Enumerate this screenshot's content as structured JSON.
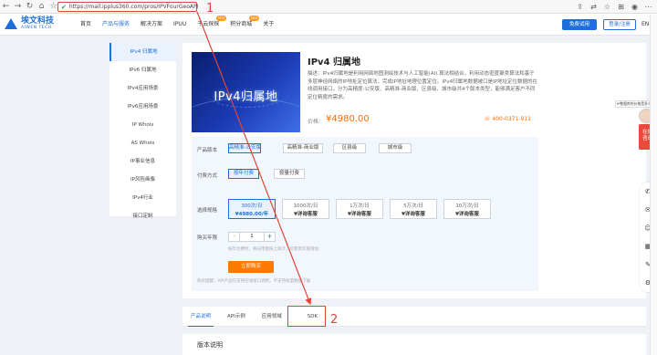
{
  "browser": {
    "url": "https://mail.ipplus360.com/pros/IPVFourGeoAPI"
  },
  "header": {
    "logo_cn": "埃文科技",
    "logo_en": "AIWEN TECH",
    "menu": [
      {
        "label": "首页",
        "badge": ""
      },
      {
        "label": "产品与服务",
        "badge": ""
      },
      {
        "label": "解决方案",
        "badge": ""
      },
      {
        "label": "IPUU",
        "badge": ""
      },
      {
        "label": "千云探探",
        "badge": "Hot"
      },
      {
        "label": "积分商城",
        "badge": "Hot"
      },
      {
        "label": "关于",
        "badge": ""
      }
    ],
    "trial_button": "免费试用",
    "login_button": "登录/注册",
    "lang": "EN"
  },
  "sidebar": {
    "items": [
      {
        "label": "IPv4 归属地"
      },
      {
        "label": "IPv6 归属地"
      },
      {
        "label": "IPv4应用场景"
      },
      {
        "label": "IPv6应用场景"
      },
      {
        "label": "IP Whois"
      },
      {
        "label": "AS Whois"
      },
      {
        "label": "IP事业信息"
      },
      {
        "label": "IP风险画像"
      },
      {
        "label": "IPv4行业"
      },
      {
        "label": "接口定制"
      }
    ]
  },
  "product": {
    "banner_text": "IPv4归属地",
    "title": "IPv4 归属地",
    "description": "描述：IPv4归属地是利用网络地图测绘技术与人工智能(AI) 算法相结合，利用动态密度聚类算法和基于多层神经网络的IP地址定位算法，完成IP地址地理位置定位。IPv4归属地数据被口是IP地址定位数据的在线调用接口，分为高精度-公安版、高精准-商业版、区县级、城市级共4个版本类型，能够满足客户不同定位精度的需求。",
    "price_label": "价格：",
    "price": "¥4980.00",
    "phone": "400-0371-911"
  },
  "options": {
    "version_label": "产品版本",
    "versions": [
      "高精准-公安版",
      "高精准-商业版",
      "区县级",
      "城市级"
    ],
    "pay_label": "付费方式",
    "pay_methods": [
      "按年付费",
      "按量付费"
    ],
    "spec_label": "选择规格",
    "plans": [
      {
        "top": "300次/日",
        "price": "¥4980.00/年"
      },
      {
        "top": "1000次/日",
        "price": "¥详询客服"
      },
      {
        "top": "1万次/日",
        "price": "¥详询客服"
      },
      {
        "top": "5万次/日",
        "price": "¥详询客服"
      },
      {
        "top": "10万次/日",
        "price": "¥详询客服"
      }
    ],
    "years_label": "购买年限",
    "quantity": "1",
    "minus": "-",
    "plus": "+",
    "hint1": "按年付费时，每日用量按上限计，可使用年限增加",
    "buy_button": "立即购买",
    "hint2": "购买提醒：API产品仅支持在线接口调用，不支持批量数据下载"
  },
  "tabs": [
    "产品说明",
    "API示例",
    "应用领域",
    "SDK"
  ],
  "section2_title": "版本说明",
  "annotations": {
    "one": "1",
    "two": "2"
  },
  "float": {
    "top_tip": "IP数据库的价格是多少？",
    "chat_line1": "在线",
    "chat_line2": "咨询"
  },
  "icons": {
    "back": "arrow-left",
    "forward": "arrow-right",
    "reload": "reload",
    "home": "home",
    "lock": "shield-check"
  }
}
